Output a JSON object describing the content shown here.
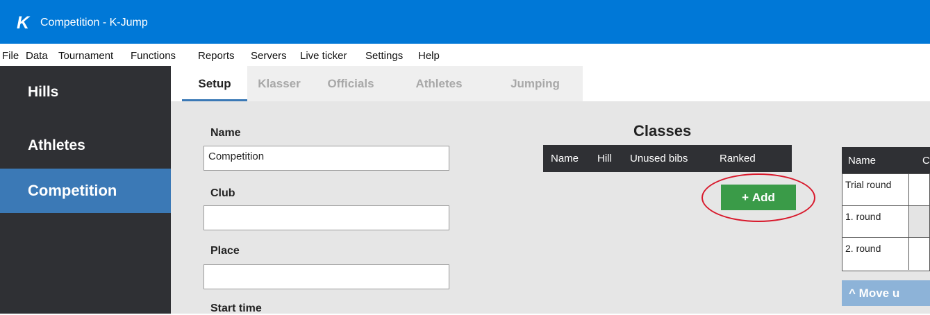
{
  "window": {
    "logo_letter": "K",
    "title": "Competition - K-Jump"
  },
  "menu": [
    "File",
    "Data",
    "Tournament",
    "Functions",
    "Reports",
    "Servers",
    "Live ticker",
    "Settings",
    "Help"
  ],
  "sidebar": {
    "items": [
      {
        "label": "Hills"
      },
      {
        "label": "Athletes"
      },
      {
        "label": "Competition",
        "active": true
      }
    ]
  },
  "tabs": [
    {
      "label": "Setup",
      "active": true
    },
    {
      "label": "Klasser"
    },
    {
      "label": "Officials"
    },
    {
      "label": "Athletes"
    },
    {
      "label": "Jumping"
    }
  ],
  "form": {
    "name_label": "Name",
    "name_value": "Competition",
    "club_label": "Club",
    "club_value": "",
    "place_label": "Place",
    "place_value": "",
    "start_time_label": "Start time"
  },
  "classes": {
    "title": "Classes",
    "columns": [
      "Name",
      "Hill",
      "Unused bibs",
      "Ranked"
    ],
    "add_icon": "+",
    "add_label": "Add"
  },
  "rounds": {
    "columns": [
      "Name",
      "C"
    ],
    "rows": [
      "Trial round",
      "1. round",
      "2. round"
    ],
    "move_icon": "^",
    "move_label": "Move u"
  },
  "colors": {
    "accent": "#0078d7",
    "sidebar": "#2f3034",
    "active_nav": "#3b79b6",
    "add_button": "#3a9b48",
    "highlight_oval": "#d8182b"
  }
}
